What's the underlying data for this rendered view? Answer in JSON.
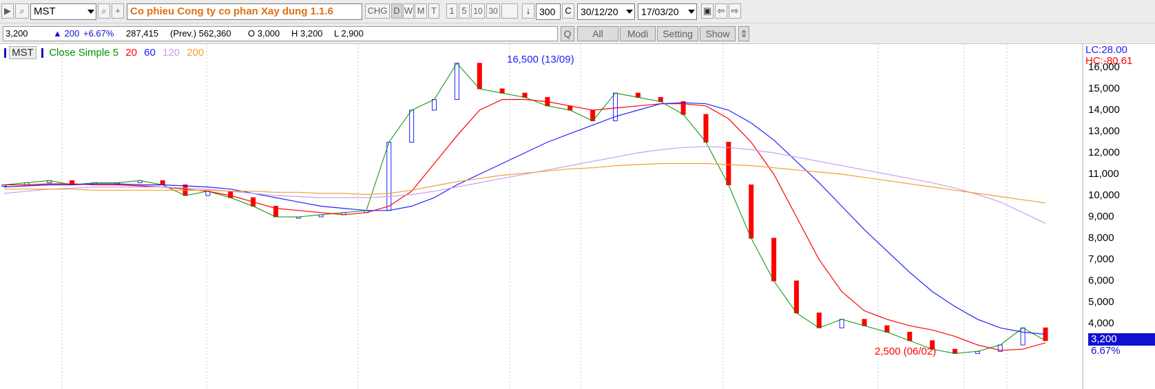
{
  "toolbar": {
    "symbol": "MST",
    "company": "Co phieu Cong ty co phan Xay dung 1.1.6",
    "chg": "CHG",
    "periods": [
      "D",
      "W",
      "M",
      "T"
    ],
    "intervals": [
      "1",
      "5",
      "10",
      "30"
    ],
    "bars": "300",
    "c_label": "C",
    "date_from": "30/12/20",
    "date_to": "17/03/20"
  },
  "quote": {
    "last": "3,200",
    "change": "▲ 200",
    "change_pct": "+6.67%",
    "volume": "287,415",
    "prev": "(Prev.) 562,360",
    "open": "O 3,000",
    "high": "H 3,200",
    "low": "L 2,900"
  },
  "buttons": {
    "q": "Q",
    "all": "All",
    "modi": "Modi",
    "setting": "Setting",
    "show": "Show"
  },
  "legend": {
    "symbol": "MST",
    "ma_label": "Close Simple 5",
    "ma20": "20",
    "ma60": "60",
    "ma120": "120",
    "ma200": "200"
  },
  "axis": {
    "lc": "LC:28.00",
    "hc": "HC:-80.61",
    "ticks": [
      "16,000",
      "15,000",
      "14,000",
      "13,000",
      "12,000",
      "11,000",
      "10,000",
      "9,000",
      "8,000",
      "7,000",
      "6,000",
      "5,000",
      "4,000"
    ],
    "last_price": "3,200",
    "last_pct": "6.67%"
  },
  "annotations": {
    "high": "16,500 (13/09)",
    "low": "2,500 (06/02)"
  },
  "colors": {
    "up": "#2020ff",
    "down": "#ff0000",
    "ma5": "#009000",
    "ma20": "#ff0000",
    "ma60": "#2020ff",
    "ma120": "#c8a0f0",
    "ma200": "#f0a030"
  },
  "chart_data": {
    "type": "line",
    "y_ticks": [
      16000,
      15000,
      14000,
      13000,
      12000,
      11000,
      10000,
      9000,
      8000,
      7000,
      6000,
      5000,
      4000
    ],
    "series": [
      {
        "name": "Close",
        "values": [
          10500,
          10600,
          10700,
          10500,
          10600,
          10600,
          10700,
          10500,
          10000,
          10200,
          9900,
          9500,
          9000,
          9000,
          9100,
          9200,
          9300,
          12500,
          14000,
          14500,
          16200,
          15000,
          14800,
          14600,
          14200,
          14000,
          13500,
          14800,
          14600,
          14400,
          13800,
          12500,
          10500,
          8000,
          6000,
          4500,
          3800,
          4200,
          3900,
          3600,
          3200,
          2800,
          2600,
          2700,
          3000,
          3800,
          3200
        ]
      },
      {
        "name": "20",
        "values": [
          10500,
          10500,
          10550,
          10550,
          10500,
          10500,
          10450,
          10400,
          10300,
          10200,
          10000,
          9700,
          9400,
          9300,
          9200,
          9100,
          9200,
          9500,
          10200,
          11500,
          12800,
          14000,
          14500,
          14500,
          14400,
          14200,
          14000,
          14100,
          14200,
          14300,
          14300,
          14200,
          13600,
          12500,
          11000,
          9000,
          7000,
          5500,
          4600,
          4200,
          3900,
          3700,
          3400,
          3000,
          2750,
          2800,
          3100
        ]
      },
      {
        "name": "60",
        "values": [
          10400,
          10450,
          10500,
          10500,
          10550,
          10550,
          10500,
          10500,
          10450,
          10400,
          10300,
          10100,
          9900,
          9700,
          9500,
          9400,
          9300,
          9300,
          9500,
          9900,
          10500,
          11000,
          11500,
          12000,
          12500,
          12900,
          13300,
          13700,
          14000,
          14300,
          14350,
          14300,
          14000,
          13400,
          12600,
          11600,
          10600,
          9500,
          8400,
          7400,
          6400,
          5500,
          4800,
          4200,
          3800,
          3600,
          3500
        ]
      },
      {
        "name": "120",
        "values": [
          10100,
          10200,
          10300,
          10350,
          10400,
          10400,
          10400,
          10400,
          10350,
          10300,
          10200,
          10100,
          10000,
          9950,
          9900,
          9900,
          9900,
          9950,
          10050,
          10200,
          10400,
          10600,
          10800,
          11000,
          11200,
          11400,
          11600,
          11800,
          12000,
          12150,
          12250,
          12300,
          12250,
          12150,
          12000,
          11800,
          11600,
          11400,
          11200,
          11000,
          10800,
          10600,
          10350,
          10050,
          9700,
          9200,
          8700
        ]
      },
      {
        "name": "200",
        "values": [
          10300,
          10300,
          10300,
          10300,
          10250,
          10250,
          10250,
          10250,
          10250,
          10250,
          10200,
          10200,
          10150,
          10150,
          10100,
          10100,
          10050,
          10100,
          10250,
          10450,
          10650,
          10800,
          10950,
          11050,
          11150,
          11250,
          11300,
          11400,
          11450,
          11500,
          11500,
          11500,
          11450,
          11400,
          11300,
          11200,
          11100,
          11000,
          10850,
          10700,
          10550,
          10400,
          10250,
          10100,
          9950,
          9800,
          9650
        ]
      }
    ]
  }
}
